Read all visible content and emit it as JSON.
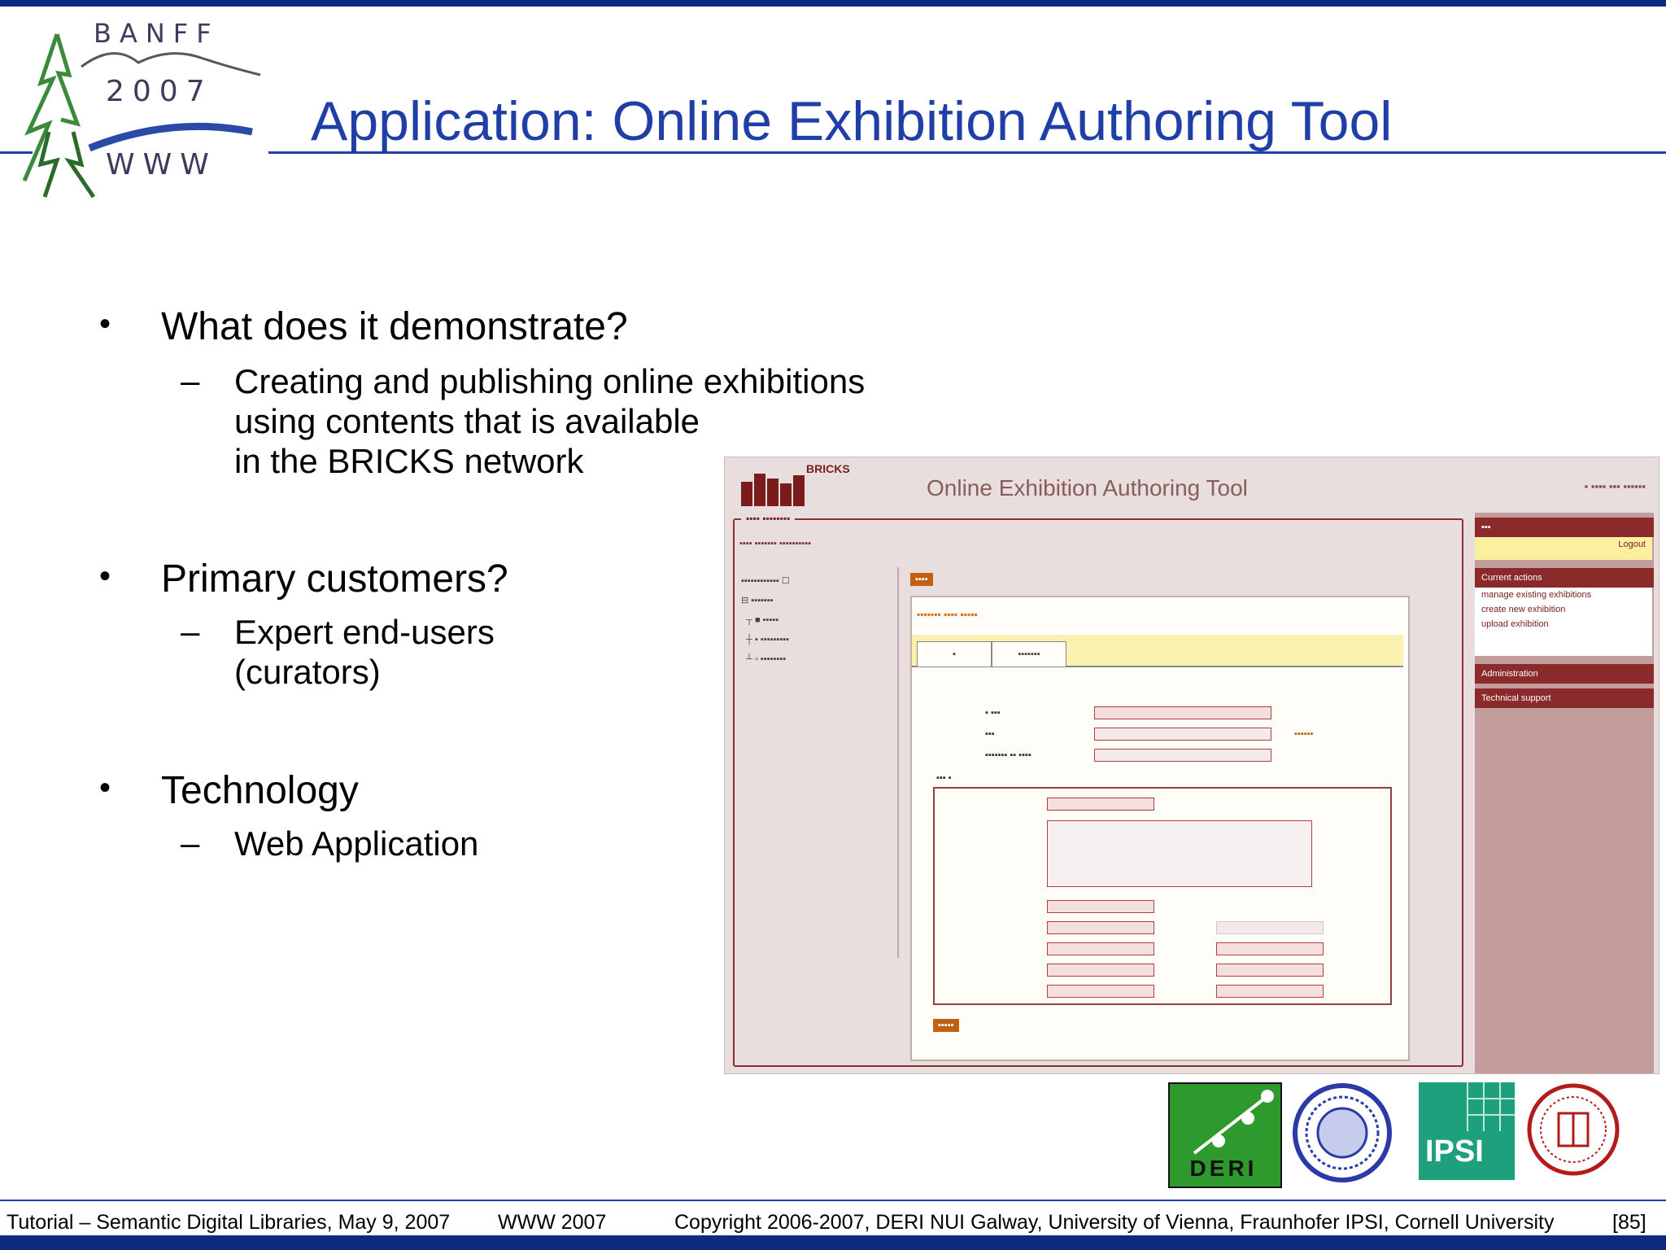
{
  "logo": {
    "line1": "BANFF",
    "line2": "2007",
    "line3": "WWW"
  },
  "title": "Application: Online Exhibition Authoring Tool",
  "bullets": [
    {
      "text": "What does it demonstrate?",
      "sub": [
        "Creating and publishing online exhibitions",
        "using contents that is available",
        "in the BRICKS network"
      ]
    },
    {
      "text": "Primary customers?",
      "sub": [
        "Expert end-users",
        "(curators)"
      ]
    },
    {
      "text": "Technology",
      "sub": [
        "Web Application"
      ]
    }
  ],
  "bullet_symbol": "•",
  "dash_symbol": "–",
  "screenshot": {
    "logo_name": "BRICKS",
    "title": "Online Exhibition Authoring Tool",
    "sidebar_login": "Logout",
    "sidebar_headings": [
      "Current actions",
      "Administration",
      "Technical support"
    ],
    "sidebar_items": [
      "manage existing exhibitions",
      "create new exhibition",
      "upload exhibition"
    ]
  },
  "partner_logos": {
    "deri": "DERI",
    "ipsi": "IPSI"
  },
  "footer": {
    "left": "Tutorial – Semantic Digital Libraries, May 9, 2007",
    "center": "WWW 2007",
    "right": "Copyright 2006-2007, DERI NUI Galway, University of Vienna, Fraunhofer IPSI, Cornell University",
    "page": "[85]"
  },
  "colors": {
    "title": "#1f3fa6",
    "bar": "#0b2a80",
    "app_accent": "#8a2a2a"
  }
}
